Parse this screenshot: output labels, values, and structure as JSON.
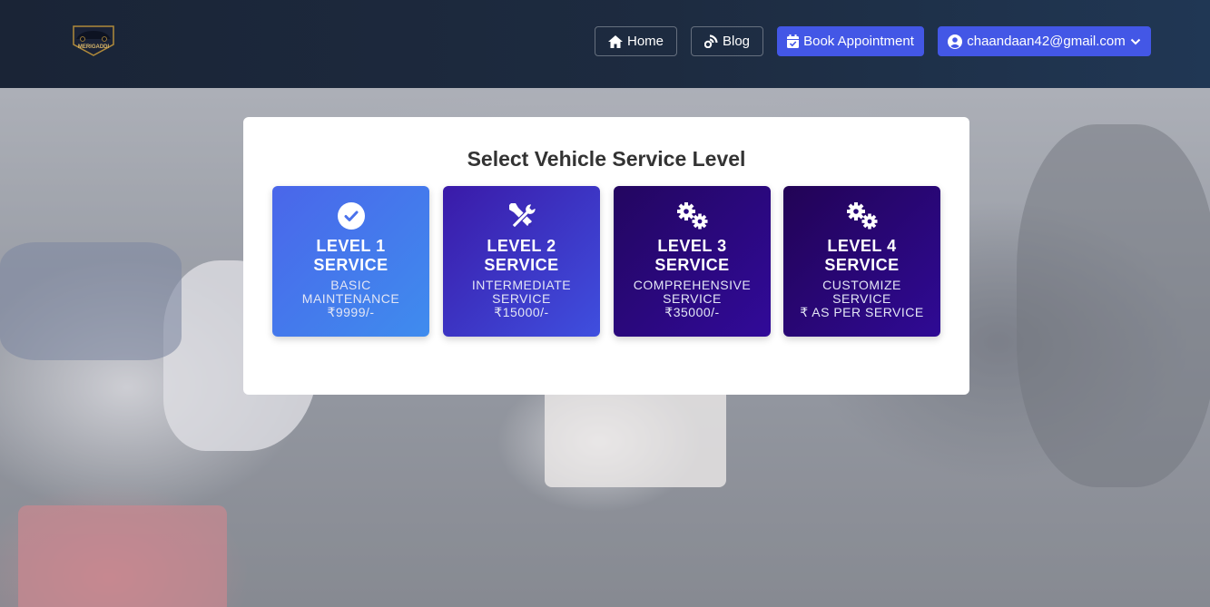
{
  "header": {
    "logo_text": "MERIGADDI",
    "nav": {
      "home_label": "Home",
      "blog_label": "Blog",
      "book_label": "Book Appointment",
      "user_email": "chaandaan42@gmail.com"
    },
    "icons": {
      "home": "home-icon",
      "blog": "blog-icon",
      "book": "calendar-check-icon",
      "user": "user-circle-icon",
      "dropdown": "chevron-down-icon"
    },
    "colors": {
      "primary_button": "#4357e6",
      "navbar_bg": "#1a2436"
    }
  },
  "panel": {
    "title": "Select Vehicle Service Level",
    "cards": [
      {
        "level": "LEVEL 1",
        "service": "SERVICE",
        "line1": "BASIC",
        "line2": "MAINTENANCE",
        "price": "₹9999/-",
        "icon": "check-circle-icon"
      },
      {
        "level": "LEVEL 2",
        "service": "SERVICE",
        "line1": "INTERMEDIATE",
        "line2": "SERVICE",
        "price": "₹15000/-",
        "icon": "tools-icon"
      },
      {
        "level": "LEVEL 3",
        "service": "SERVICE",
        "line1": "COMPREHENSIVE",
        "line2": "SERVICE",
        "price": "₹35000/-",
        "icon": "gears-icon"
      },
      {
        "level": "LEVEL 4",
        "service": "SERVICE",
        "line1": "CUSTOMIZE",
        "line2": "SERVICE",
        "price": "₹ AS PER SERVICE",
        "icon": "gears-icon"
      }
    ]
  }
}
